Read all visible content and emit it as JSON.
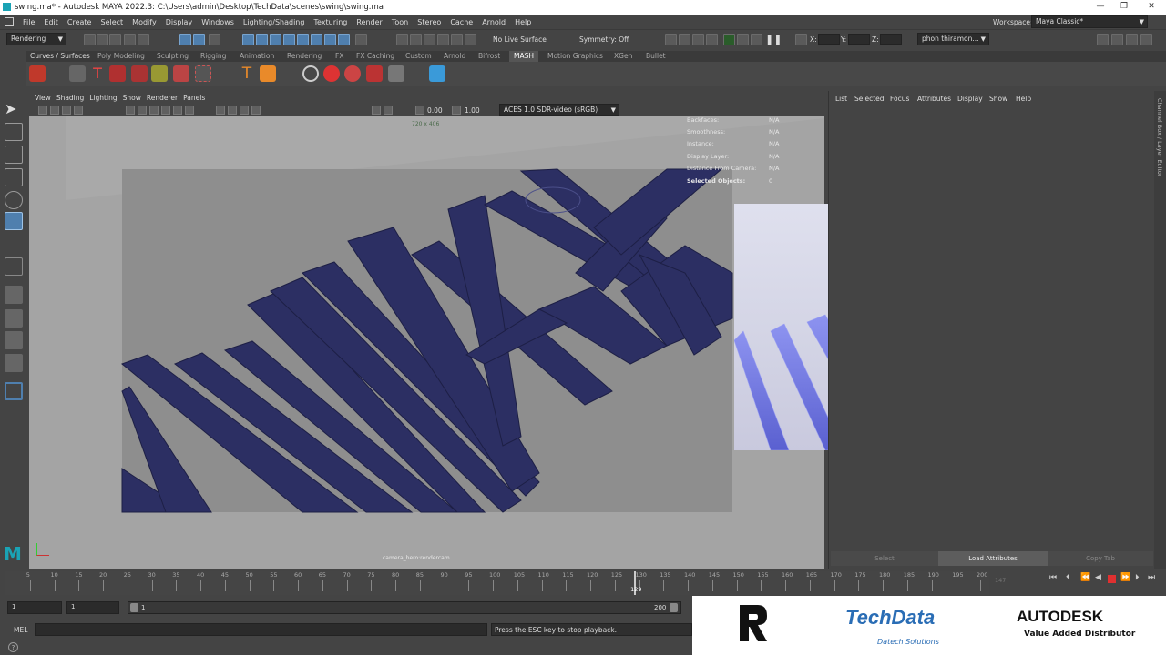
{
  "window": {
    "title": "swing.ma* - Autodesk MAYA 2022.3: C:\\Users\\admin\\Desktop\\TechData\\scenes\\swing\\swing.ma",
    "minimize": "—",
    "restore": "❐",
    "close": "✕"
  },
  "menubar": [
    "File",
    "Edit",
    "Create",
    "Select",
    "Modify",
    "Display",
    "Windows",
    "Lighting/Shading",
    "Texturing",
    "Render",
    "Toon",
    "Stereo",
    "Cache",
    "Arnold",
    "Help"
  ],
  "workspace": {
    "label": "Workspace:",
    "value": "Maya Classic*"
  },
  "statusline": {
    "menuset": "Rendering",
    "live_surface": "No Live Surface",
    "symmetry": "Symmetry: Off",
    "x_label": "X:",
    "y_label": "Y:",
    "z_label": "Z:",
    "user": "phon thiramon..."
  },
  "shelf_tabs": [
    "Curves / Surfaces",
    "Poly Modeling",
    "Sculpting",
    "Rigging",
    "Animation",
    "Rendering",
    "FX",
    "FX Caching",
    "Custom",
    "Arnold",
    "Bifrost",
    "MASH",
    "Motion Graphics",
    "XGen",
    "Bullet"
  ],
  "shelf_active": "MASH",
  "viewport": {
    "menus": [
      "View",
      "Shading",
      "Lighting",
      "Show",
      "Renderer",
      "Panels"
    ],
    "exposure": "0.00",
    "gamma": "1.00",
    "color_space": "ACES 1.0 SDR-video (sRGB)",
    "resolution": "720 x 406",
    "camera": "camera_hero:rendercam"
  },
  "hud": [
    {
      "key": "Backfaces:",
      "value": "N/A"
    },
    {
      "key": "Smoothness:",
      "value": "N/A"
    },
    {
      "key": "Instance:",
      "value": "N/A"
    },
    {
      "key": "Display Layer:",
      "value": "N/A"
    },
    {
      "key": "Distance From Camera:",
      "value": "N/A"
    },
    {
      "key": "Selected Objects:",
      "value": "0"
    }
  ],
  "channel_box": {
    "menus": [
      "List",
      "Selected",
      "Focus",
      "Attributes",
      "Display",
      "Show",
      "Help"
    ],
    "side_tab": "Channel Box / Layer Editor",
    "buttons": [
      "Select",
      "Load Attributes",
      "Copy Tab"
    ]
  },
  "timeline": {
    "ticks": [
      "5",
      "10",
      "15",
      "20",
      "25",
      "30",
      "35",
      "40",
      "45",
      "50",
      "55",
      "60",
      "65",
      "70",
      "75",
      "80",
      "85",
      "90",
      "95",
      "100",
      "105",
      "110",
      "115",
      "120",
      "125",
      "130",
      "135",
      "140",
      "145",
      "150",
      "155",
      "160",
      "165",
      "170",
      "175",
      "180",
      "185",
      "190",
      "195",
      "200"
    ],
    "current_frame": "129",
    "current_field": "147"
  },
  "range": {
    "start": "1",
    "start2": "1",
    "slider_start": "1",
    "slider_end": "200"
  },
  "command": {
    "label": "MEL",
    "status": "Press the ESC key to stop playback."
  },
  "logos": {
    "techdata": "TechData",
    "techdata_sub": "Datech Solutions",
    "autodesk": "AUTODESK",
    "autodesk_sub": "Value Added Distributor"
  },
  "colors": {
    "accent": "#4f7fae",
    "viewport_bg": "#a4a4a4",
    "bars_dark": "#2c2f63",
    "bars_render": "#7a80e0"
  }
}
